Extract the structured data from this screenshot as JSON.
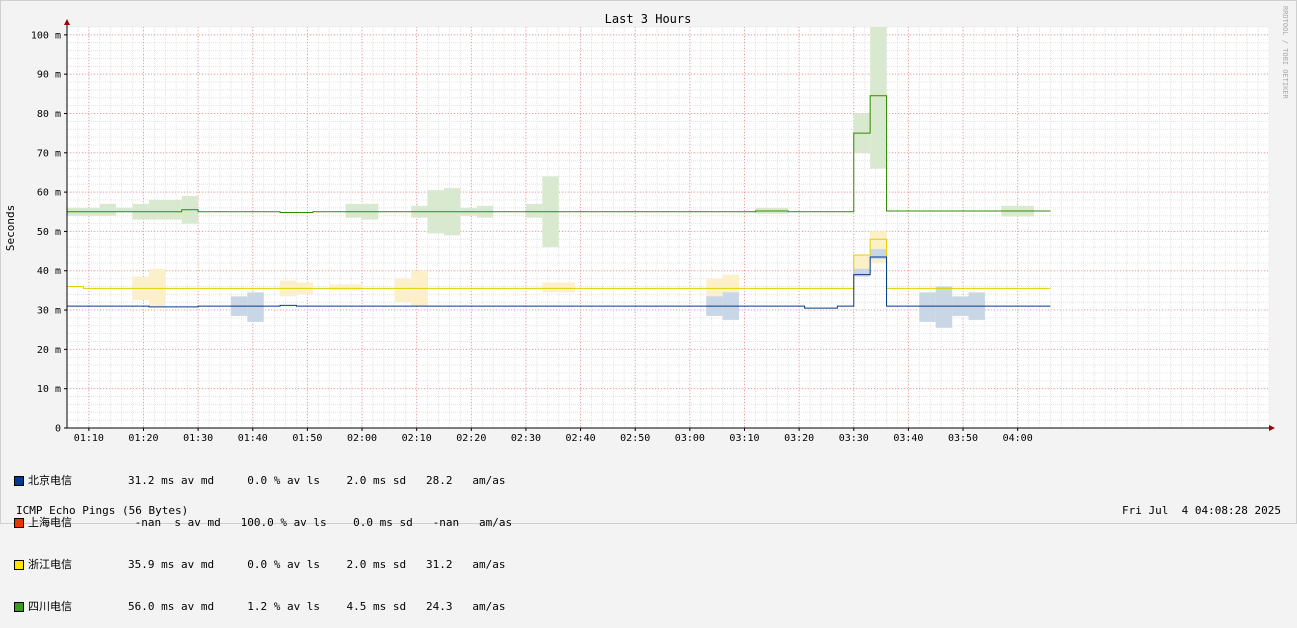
{
  "chart_data": {
    "type": "line",
    "title": "Last 3 Hours",
    "ylabel": "Seconds",
    "watermark": "RRDTOOL / TOBI OETIKER",
    "ylim": [
      0,
      102
    ],
    "xlim": [
      "01:06",
      "04:46"
    ],
    "y_ticks": [
      {
        "v": 0,
        "label": "0"
      },
      {
        "v": 10,
        "label": "10 m"
      },
      {
        "v": 20,
        "label": "20 m"
      },
      {
        "v": 30,
        "label": "30 m"
      },
      {
        "v": 40,
        "label": "40 m"
      },
      {
        "v": 50,
        "label": "50 m"
      },
      {
        "v": 60,
        "label": "60 m"
      },
      {
        "v": 70,
        "label": "70 m"
      },
      {
        "v": 80,
        "label": "80 m"
      },
      {
        "v": 90,
        "label": "90 m"
      },
      {
        "v": 100,
        "label": "100 m"
      }
    ],
    "x_ticks": [
      "01:10",
      "01:20",
      "01:30",
      "01:40",
      "01:50",
      "02:00",
      "02:10",
      "02:20",
      "02:30",
      "02:40",
      "02:50",
      "03:00",
      "03:10",
      "03:20",
      "03:30",
      "03:40",
      "03:50",
      "04:00"
    ],
    "grid": true,
    "series": [
      {
        "name": "四川电信",
        "color": "#2e8b00",
        "band_color": "#d9e9cf",
        "steps": [
          {
            "t": "01:06",
            "v": 55.0,
            "lo": 54.0,
            "hi": 56.0
          },
          {
            "t": "01:09",
            "v": 55.0,
            "lo": 54.0,
            "hi": 56.0
          },
          {
            "t": "01:12",
            "v": 55.0,
            "lo": 54.0,
            "hi": 57.0
          },
          {
            "t": "01:15",
            "v": 55.0,
            "lo": 55.0,
            "hi": 56.0
          },
          {
            "t": "01:18",
            "v": 55.0,
            "lo": 53.0,
            "hi": 57.0
          },
          {
            "t": "01:21",
            "v": 55.0,
            "lo": 53.0,
            "hi": 58.0
          },
          {
            "t": "01:24",
            "v": 55.0,
            "lo": 53.0,
            "hi": 58.0
          },
          {
            "t": "01:27",
            "v": 55.5,
            "lo": 52.0,
            "hi": 59.0
          },
          {
            "t": "01:30",
            "v": 55.0,
            "lo": 55.0,
            "hi": 55.0
          },
          {
            "t": "01:45",
            "v": 54.8,
            "lo": 54.8,
            "hi": 54.8
          },
          {
            "t": "01:51",
            "v": 55.0,
            "lo": 55.0,
            "hi": 55.0
          },
          {
            "t": "01:57",
            "v": 55.0,
            "lo": 53.5,
            "hi": 57.0
          },
          {
            "t": "02:00",
            "v": 55.0,
            "lo": 53.0,
            "hi": 57.0
          },
          {
            "t": "02:03",
            "v": 55.0,
            "lo": 55.0,
            "hi": 55.0
          },
          {
            "t": "02:09",
            "v": 55.0,
            "lo": 53.5,
            "hi": 56.5
          },
          {
            "t": "02:12",
            "v": 55.0,
            "lo": 49.5,
            "hi": 60.5
          },
          {
            "t": "02:15",
            "v": 55.0,
            "lo": 49.0,
            "hi": 61.0
          },
          {
            "t": "02:18",
            "v": 55.0,
            "lo": 54.0,
            "hi": 56.0
          },
          {
            "t": "02:21",
            "v": 55.0,
            "lo": 53.5,
            "hi": 56.5
          },
          {
            "t": "02:24",
            "v": 55.0,
            "lo": 55.0,
            "hi": 55.0
          },
          {
            "t": "02:30",
            "v": 55.0,
            "lo": 53.5,
            "hi": 57.0
          },
          {
            "t": "02:33",
            "v": 55.0,
            "lo": 46.0,
            "hi": 64.0
          },
          {
            "t": "02:36",
            "v": 55.0,
            "lo": 55.0,
            "hi": 55.0
          },
          {
            "t": "03:12",
            "v": 55.2,
            "lo": 54.5,
            "hi": 56.0
          },
          {
            "t": "03:18",
            "v": 55.0,
            "lo": 55.0,
            "hi": 55.0
          },
          {
            "t": "03:30",
            "v": 75.0,
            "lo": 70.0,
            "hi": 80.0
          },
          {
            "t": "03:33",
            "v": 84.5,
            "lo": 66.0,
            "hi": 102.0
          },
          {
            "t": "03:36",
            "v": 55.2,
            "lo": 55.2,
            "hi": 55.2
          },
          {
            "t": "03:54",
            "v": 55.2,
            "lo": 55.2,
            "hi": 55.2
          },
          {
            "t": "03:57",
            "v": 55.2,
            "lo": 53.8,
            "hi": 56.5
          },
          {
            "t": "04:03",
            "v": 55.2,
            "lo": 55.2,
            "hi": 55.2
          },
          {
            "t": "04:06",
            "v": 55.2,
            "lo": 55.2,
            "hi": 55.2
          }
        ]
      },
      {
        "name": "浙江电信",
        "color": "#e0d000",
        "band_color": "#fbf0c8",
        "steps": [
          {
            "t": "01:06",
            "v": 36.0,
            "lo": 36.0,
            "hi": 36.0
          },
          {
            "t": "01:09",
            "v": 35.5,
            "lo": 35.5,
            "hi": 35.5
          },
          {
            "t": "01:15",
            "v": 35.5,
            "lo": 35.5,
            "hi": 35.5
          },
          {
            "t": "01:18",
            "v": 35.5,
            "lo": 32.5,
            "hi": 38.5
          },
          {
            "t": "01:21",
            "v": 35.5,
            "lo": 31.0,
            "hi": 40.5
          },
          {
            "t": "01:24",
            "v": 35.5,
            "lo": 35.5,
            "hi": 35.5
          },
          {
            "t": "01:45",
            "v": 35.5,
            "lo": 33.5,
            "hi": 37.5
          },
          {
            "t": "01:48",
            "v": 35.5,
            "lo": 34.0,
            "hi": 37.0
          },
          {
            "t": "01:51",
            "v": 35.5,
            "lo": 35.5,
            "hi": 35.5
          },
          {
            "t": "01:54",
            "v": 35.5,
            "lo": 35.0,
            "hi": 36.5
          },
          {
            "t": "02:00",
            "v": 35.5,
            "lo": 35.5,
            "hi": 35.5
          },
          {
            "t": "02:06",
            "v": 35.5,
            "lo": 32.0,
            "hi": 38.0
          },
          {
            "t": "02:09",
            "v": 35.5,
            "lo": 31.0,
            "hi": 40.0
          },
          {
            "t": "02:12",
            "v": 35.5,
            "lo": 35.5,
            "hi": 35.5
          },
          {
            "t": "02:30",
            "v": 35.5,
            "lo": 35.5,
            "hi": 35.5
          },
          {
            "t": "02:33",
            "v": 35.5,
            "lo": 34.5,
            "hi": 37.0
          },
          {
            "t": "02:39",
            "v": 35.5,
            "lo": 35.5,
            "hi": 35.5
          },
          {
            "t": "03:03",
            "v": 35.5,
            "lo": 33.0,
            "hi": 38.0
          },
          {
            "t": "03:06",
            "v": 35.5,
            "lo": 32.5,
            "hi": 39.0
          },
          {
            "t": "03:09",
            "v": 35.5,
            "lo": 35.5,
            "hi": 35.5
          },
          {
            "t": "03:30",
            "v": 44.0,
            "lo": 38.5,
            "hi": 44.0
          },
          {
            "t": "03:33",
            "v": 48.0,
            "lo": 42.0,
            "hi": 50.0
          },
          {
            "t": "03:36",
            "v": 35.5,
            "lo": 35.5,
            "hi": 35.5
          },
          {
            "t": "04:06",
            "v": 35.5,
            "lo": 35.5,
            "hi": 35.5
          }
        ]
      },
      {
        "name": "北京电信",
        "color": "#003a8c",
        "band_color": "#c9d6e6",
        "steps": [
          {
            "t": "01:06",
            "v": 31.0,
            "lo": 31.0,
            "hi": 31.0
          },
          {
            "t": "01:21",
            "v": 30.8,
            "lo": 30.8,
            "hi": 30.8
          },
          {
            "t": "01:30",
            "v": 31.0,
            "lo": 31.0,
            "hi": 31.0
          },
          {
            "t": "01:36",
            "v": 31.0,
            "lo": 28.5,
            "hi": 33.5
          },
          {
            "t": "01:39",
            "v": 31.0,
            "lo": 27.0,
            "hi": 34.5
          },
          {
            "t": "01:42",
            "v": 31.0,
            "lo": 31.0,
            "hi": 31.0
          },
          {
            "t": "01:45",
            "v": 31.2,
            "lo": 31.2,
            "hi": 31.2
          },
          {
            "t": "01:48",
            "v": 31.0,
            "lo": 31.0,
            "hi": 31.0
          },
          {
            "t": "03:03",
            "v": 31.0,
            "lo": 28.5,
            "hi": 33.5
          },
          {
            "t": "03:06",
            "v": 31.0,
            "lo": 27.5,
            "hi": 34.5
          },
          {
            "t": "03:09",
            "v": 31.0,
            "lo": 31.0,
            "hi": 31.0
          },
          {
            "t": "03:21",
            "v": 30.5,
            "lo": 30.5,
            "hi": 30.5
          },
          {
            "t": "03:27",
            "v": 31.0,
            "lo": 31.0,
            "hi": 31.0
          },
          {
            "t": "03:30",
            "v": 39.0,
            "lo": 38.5,
            "hi": 40.5
          },
          {
            "t": "03:33",
            "v": 43.5,
            "lo": 43.0,
            "hi": 45.5
          },
          {
            "t": "03:36",
            "v": 31.0,
            "lo": 31.0,
            "hi": 31.0
          },
          {
            "t": "03:42",
            "v": 31.0,
            "lo": 27.0,
            "hi": 34.5
          },
          {
            "t": "03:45",
            "v": 31.0,
            "lo": 25.5,
            "hi": 36.0
          },
          {
            "t": "03:48",
            "v": 31.0,
            "lo": 28.5,
            "hi": 33.5
          },
          {
            "t": "03:51",
            "v": 31.0,
            "lo": 27.5,
            "hi": 34.5
          },
          {
            "t": "03:54",
            "v": 31.0,
            "lo": 31.0,
            "hi": 31.0
          },
          {
            "t": "04:06",
            "v": 31.0,
            "lo": 31.0,
            "hi": 31.0
          }
        ]
      }
    ]
  },
  "legend": [
    {
      "name": "北京电信",
      "color": "#003a8c",
      "stats": "31.2 ms av md     0.0 % av ls    2.0 ms sd   28.2   am/as"
    },
    {
      "name": "上海电信",
      "color": "#ee3300",
      "stats": " -nan  s av md   100.0 % av ls    0.0 ms sd   -nan   am/as"
    },
    {
      "name": "浙江电信",
      "color": "#ffe400",
      "stats": "35.9 ms av md     0.0 % av ls    2.0 ms sd   31.2   am/as"
    },
    {
      "name": "四川电信",
      "color": "#3a9a22",
      "stats": "56.0 ms av md     1.2 % av ls    4.5 ms sd   24.3   am/as"
    }
  ],
  "footer": {
    "left": "ICMP Echo Pings (56 Bytes)",
    "right": "Fri Jul  4 04:08:28 2025"
  }
}
